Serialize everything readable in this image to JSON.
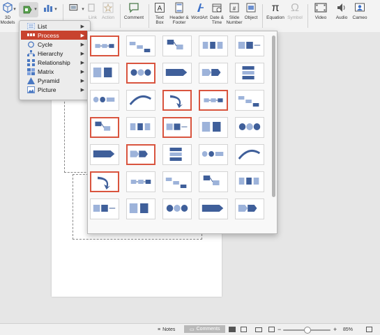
{
  "ribbon": {
    "items": [
      {
        "label_line1": "3D",
        "label_line2": "Models",
        "icon": "cube-icon"
      },
      {
        "label_line1": "",
        "label_line2": "",
        "icon": "smartart-icon"
      },
      {
        "label_line1": "",
        "label_line2": "",
        "icon": "chart-icon"
      },
      {
        "label_line1": "",
        "label_line2": "",
        "icon": "screenshot-icon"
      },
      {
        "label_line1": "Link",
        "label_line2": "",
        "icon": "link-icon"
      },
      {
        "label_line1": "Action",
        "label_line2": "",
        "icon": "star-icon"
      },
      {
        "label_line1": "Comment",
        "label_line2": "",
        "icon": "comment-icon"
      },
      {
        "label_line1": "Text",
        "label_line2": "Box",
        "icon": "textbox-icon"
      },
      {
        "label_line1": "Header &",
        "label_line2": "Footer",
        "icon": "header-footer-icon"
      },
      {
        "label_line1": "WordArt",
        "label_line2": "",
        "icon": "wordart-icon"
      },
      {
        "label_line1": "Date &",
        "label_line2": "Time",
        "icon": "calendar-icon"
      },
      {
        "label_line1": "Slide",
        "label_line2": "Number",
        "icon": "slide-number-icon"
      },
      {
        "label_line1": "Object",
        "label_line2": "",
        "icon": "object-icon"
      },
      {
        "label_line1": "Equation",
        "label_line2": "",
        "icon": "pi-icon"
      },
      {
        "label_line1": "Symbol",
        "label_line2": "",
        "icon": "omega-icon"
      },
      {
        "label_line1": "Video",
        "label_line2": "",
        "icon": "video-icon"
      },
      {
        "label_line1": "Audio",
        "label_line2": "",
        "icon": "speaker-icon"
      },
      {
        "label_line1": "Cameo",
        "label_line2": "",
        "icon": "cameo-icon"
      }
    ]
  },
  "smartart_menu": {
    "items": [
      {
        "label": "List",
        "icon": "list-icon",
        "selected": false
      },
      {
        "label": "Process",
        "icon": "process-icon",
        "selected": true
      },
      {
        "label": "Cycle",
        "icon": "cycle-icon",
        "selected": false
      },
      {
        "label": "Hierarchy",
        "icon": "hierarchy-icon",
        "selected": false
      },
      {
        "label": "Relationship",
        "icon": "relationship-icon",
        "selected": false
      },
      {
        "label": "Matrix",
        "icon": "matrix-icon",
        "selected": false
      },
      {
        "label": "Pyramid",
        "icon": "pyramid-icon",
        "selected": false
      },
      {
        "label": "Picture",
        "icon": "picture-icon",
        "selected": false
      }
    ],
    "accent_color": "#c8432e"
  },
  "gallery": {
    "highlight_color": "#d9543e",
    "diagram_color": "#3f5f9a",
    "highlighted": [
      [
        0,
        0
      ],
      [
        0,
        5
      ],
      [
        1,
        1
      ],
      [
        2,
        2
      ],
      [
        2,
        3
      ],
      [
        3,
        0
      ],
      [
        3,
        2
      ],
      [
        4,
        1
      ],
      [
        4,
        5
      ],
      [
        5,
        0
      ],
      [
        5,
        5
      ]
    ]
  },
  "statusbar": {
    "notes_label": "Notes",
    "comments_label": "Comments",
    "zoom_level": "85%"
  }
}
